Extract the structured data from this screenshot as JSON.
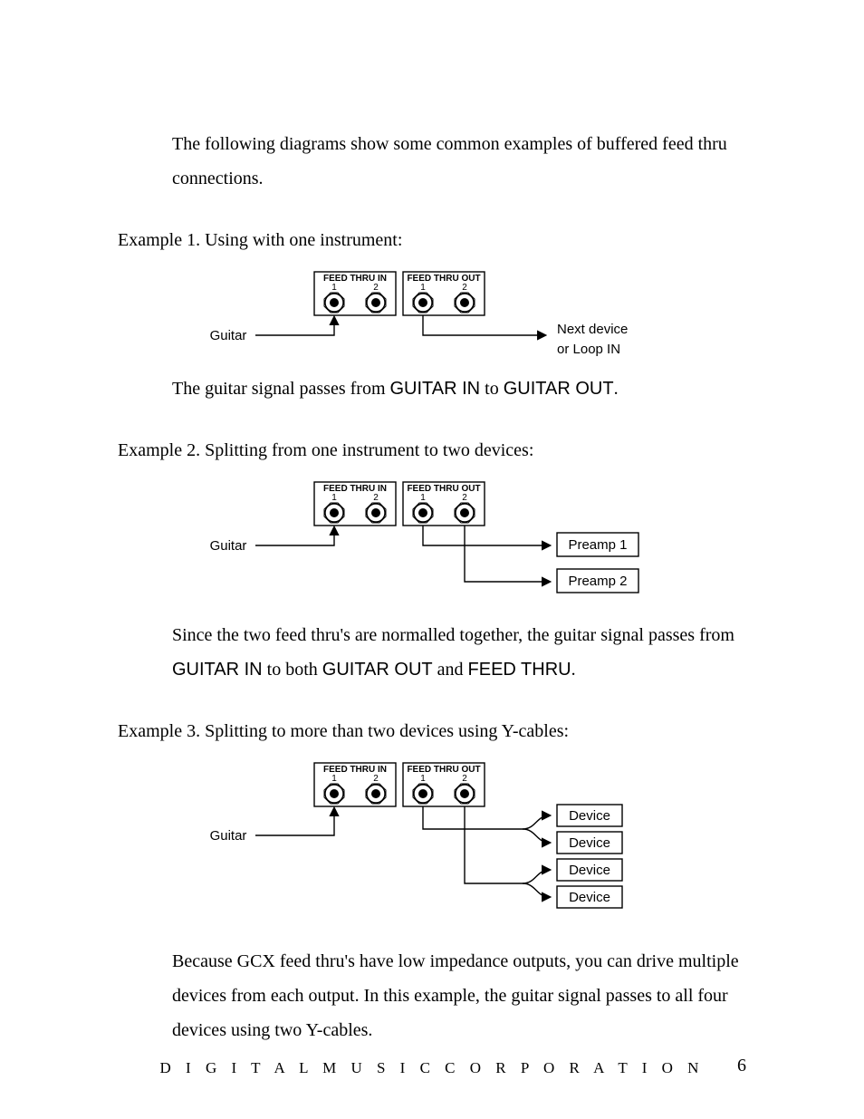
{
  "intro": "The following diagrams show some common examples of buffered feed thru connections.",
  "ex1": {
    "heading": "Example 1.  Using with one instrument:",
    "body_before": "The guitar signal passes from ",
    "g_in": "GUITAR IN",
    "mid": " to ",
    "g_out": "GUITAR OUT",
    "after": "."
  },
  "ex2": {
    "heading": "Example 2.  Splitting from one instrument to two devices:",
    "b1": "Since the two feed thru's are normalled together, the guitar signal passes from ",
    "g_in": "GUITAR IN",
    "b2": " to both ",
    "g_out": "GUITAR OUT",
    "b3": " and ",
    "ft": "FEED THRU",
    "b4": "."
  },
  "ex3": {
    "heading": "Example 3.  Splitting to more than two devices using Y-cables:",
    "body": "Because GCX feed thru's have low impedance outputs, you can drive multiple devices from each output.  In this example, the guitar signal passes to all four devices using two Y-cables."
  },
  "diagram": {
    "feed_in": "FEED THRU IN",
    "feed_out": "FEED THRU OUT",
    "one": "1",
    "two": "2",
    "guitar": "Guitar",
    "next1": "Next device",
    "next2": "or Loop IN",
    "pre1": "Preamp 1",
    "pre2": "Preamp 2",
    "device": "Device"
  },
  "footer": "DIGITAL MUSIC CORPORATION",
  "page": "6"
}
